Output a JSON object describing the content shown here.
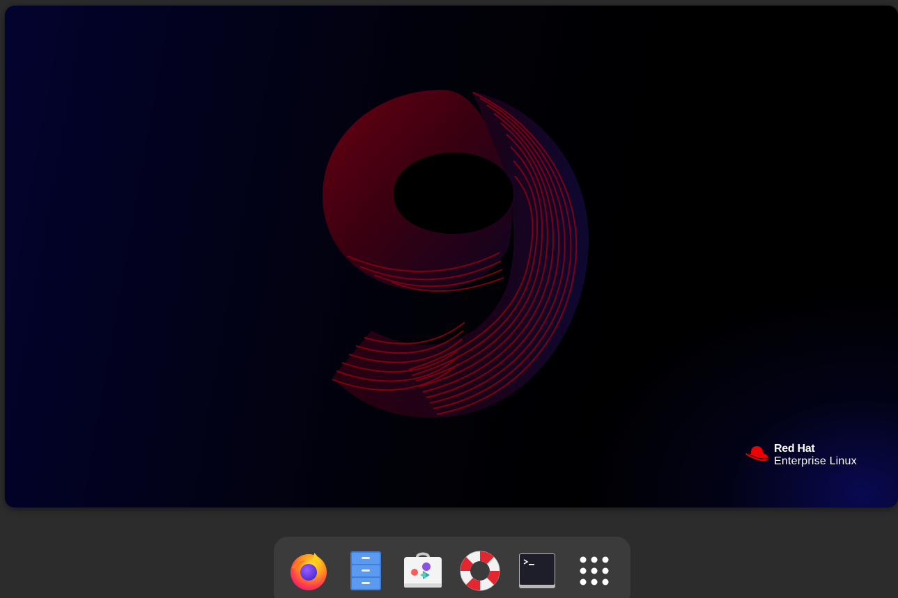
{
  "wallpaper": {
    "brand_name": "Red Hat",
    "brand_product": "Enterprise Linux",
    "colors": {
      "hat_red": "#ee0000",
      "nine_red": "#7a0010",
      "background_top_left": "#030330",
      "background_bottom_right": "#0a0a5a"
    }
  },
  "dash": {
    "items": [
      {
        "name": "Firefox",
        "icon": "firefox-icon"
      },
      {
        "name": "Files",
        "icon": "file-cabinet-icon"
      },
      {
        "name": "Software",
        "icon": "software-store-icon"
      },
      {
        "name": "Help",
        "icon": "lifebuoy-icon"
      },
      {
        "name": "Terminal",
        "icon": "terminal-icon"
      },
      {
        "name": "Show Applications",
        "icon": "app-grid-icon"
      }
    ]
  }
}
